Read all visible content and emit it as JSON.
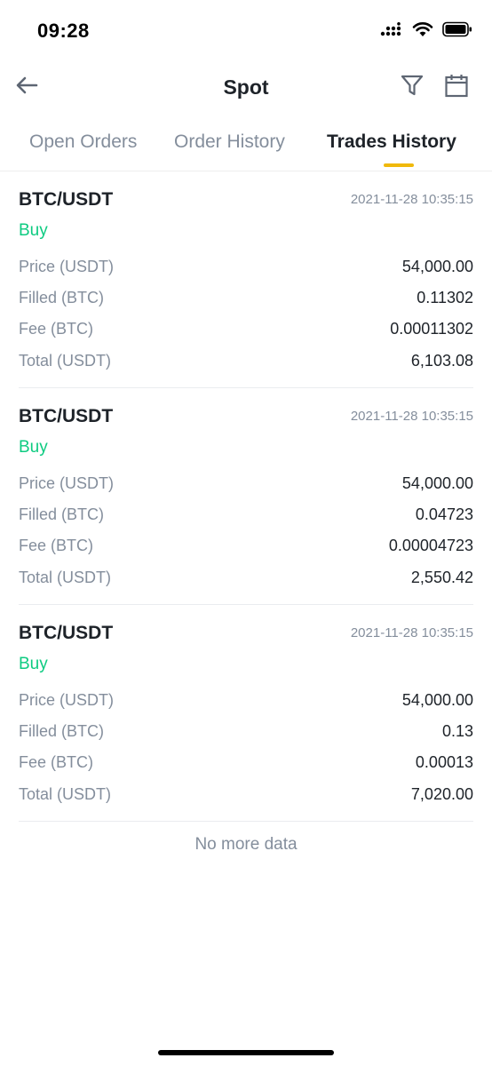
{
  "status_bar": {
    "time": "09:28"
  },
  "header": {
    "title": "Spot",
    "back_icon": "arrow-left-icon",
    "filter_icon": "filter-icon",
    "calendar_icon": "calendar-icon"
  },
  "tabs": [
    {
      "label": "Open Orders",
      "active": false
    },
    {
      "label": "Order History",
      "active": false
    },
    {
      "label": "Trades History",
      "active": true
    }
  ],
  "colors": {
    "accent": "#f0b90b",
    "buy": "#0ecb81",
    "muted": "#848e9c",
    "text": "#1e2329"
  },
  "trades": [
    {
      "pair": "BTC/USDT",
      "time": "2021-11-28 10:35:15",
      "side": "Buy",
      "rows": [
        {
          "label": "Price (USDT)",
          "value": "54,000.00"
        },
        {
          "label": "Filled (BTC)",
          "value": "0.11302"
        },
        {
          "label": "Fee (BTC)",
          "value": "0.00011302"
        },
        {
          "label": "Total (USDT)",
          "value": "6,103.08"
        }
      ]
    },
    {
      "pair": "BTC/USDT",
      "time": "2021-11-28 10:35:15",
      "side": "Buy",
      "rows": [
        {
          "label": "Price (USDT)",
          "value": "54,000.00"
        },
        {
          "label": "Filled (BTC)",
          "value": "0.04723"
        },
        {
          "label": "Fee (BTC)",
          "value": "0.00004723"
        },
        {
          "label": "Total (USDT)",
          "value": "2,550.42"
        }
      ]
    },
    {
      "pair": "BTC/USDT",
      "time": "2021-11-28 10:35:15",
      "side": "Buy",
      "rows": [
        {
          "label": "Price (USDT)",
          "value": "54,000.00"
        },
        {
          "label": "Filled (BTC)",
          "value": "0.13"
        },
        {
          "label": "Fee (BTC)",
          "value": "0.00013"
        },
        {
          "label": "Total (USDT)",
          "value": "7,020.00"
        }
      ]
    }
  ],
  "footer": {
    "no_more": "No more data"
  }
}
